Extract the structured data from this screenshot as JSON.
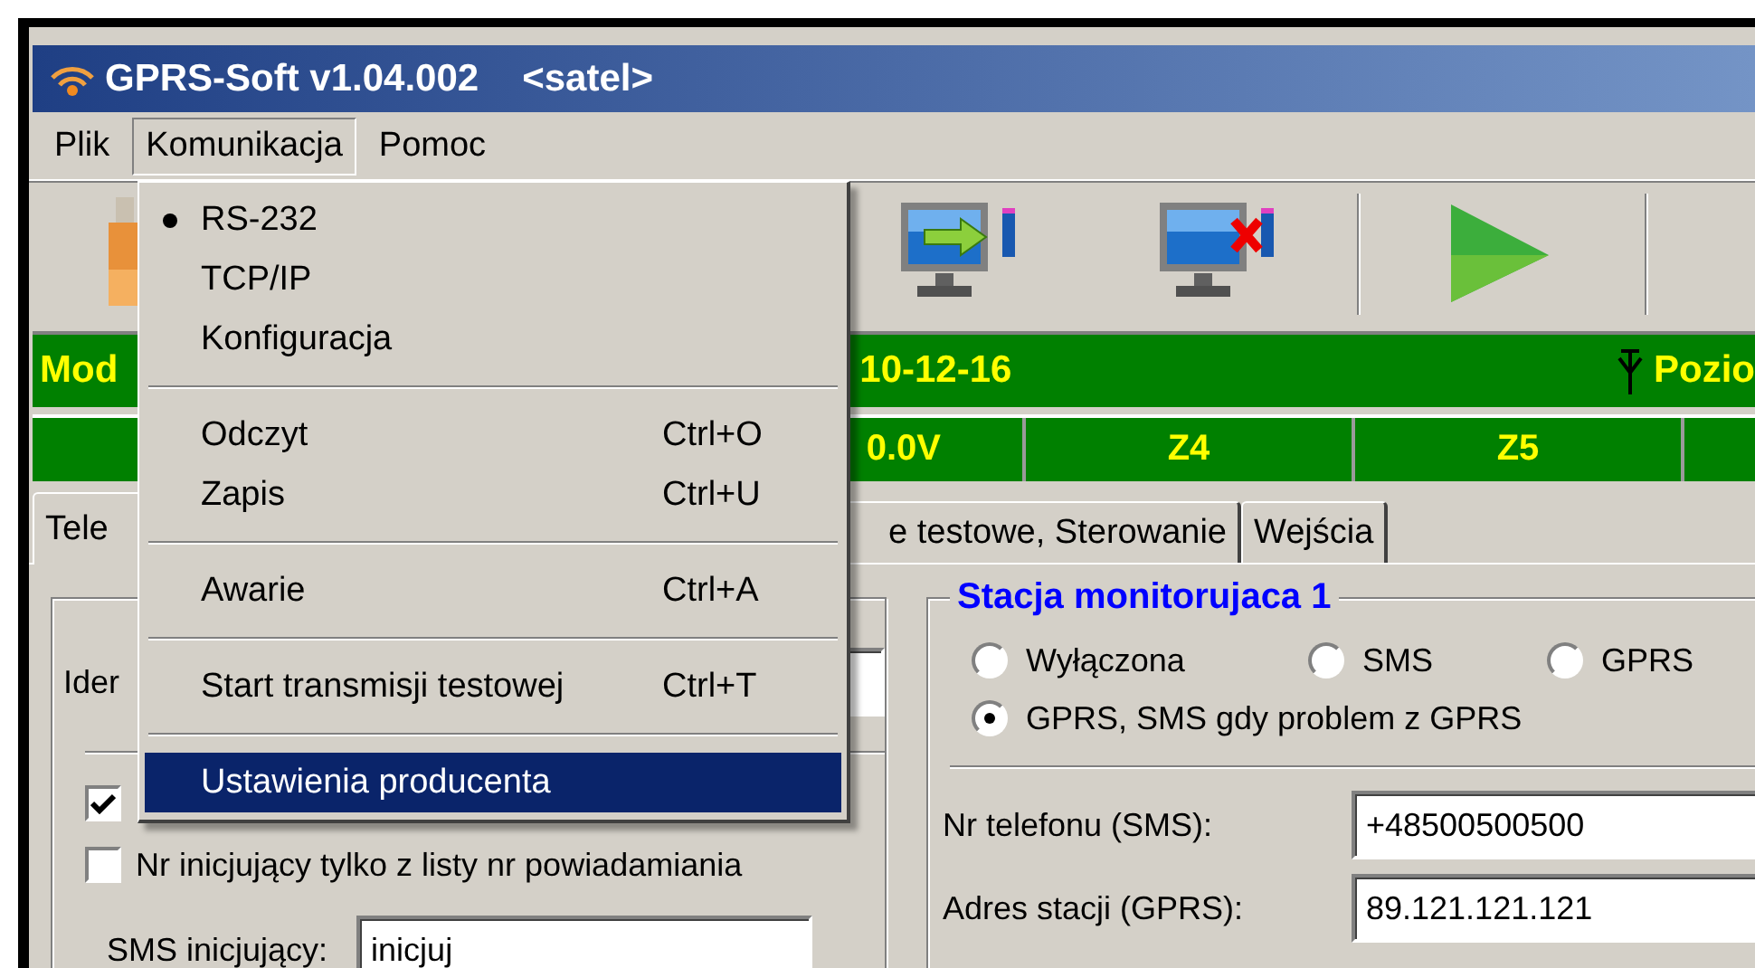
{
  "window": {
    "title": "GPRS-Soft v1.04.002",
    "subtitle": "<satel>"
  },
  "menu_bar": [
    {
      "label": "Plik",
      "selected": false
    },
    {
      "label": "Komunikacja",
      "selected": true
    },
    {
      "label": "Pomoc",
      "selected": false
    }
  ],
  "menu": [
    {
      "kind": "item",
      "label": "RS-232",
      "checked": true,
      "selected": false
    },
    {
      "kind": "item",
      "label": "TCP/IP",
      "checked": false,
      "selected": false
    },
    {
      "kind": "item",
      "label": "Konfiguracja",
      "checked": false,
      "selected": false
    },
    {
      "kind": "separator"
    },
    {
      "kind": "item",
      "label": "Odczyt",
      "shortcut": "Ctrl+O",
      "checked": false,
      "selected": false
    },
    {
      "kind": "item",
      "label": "Zapis",
      "shortcut": "Ctrl+U",
      "checked": false,
      "selected": false
    },
    {
      "kind": "separator"
    },
    {
      "kind": "item",
      "label": "Awarie",
      "shortcut": "Ctrl+A",
      "checked": false,
      "selected": false
    },
    {
      "kind": "separator"
    },
    {
      "kind": "item",
      "label": "Start transmisji testowej",
      "shortcut": "Ctrl+T",
      "checked": false,
      "selected": false
    },
    {
      "kind": "separator"
    },
    {
      "kind": "item",
      "label": "Ustawienia producenta",
      "checked": false,
      "selected": true
    }
  ],
  "status_bar": {
    "left": "Mod",
    "date": "10-12-16",
    "right": "Pozio"
  },
  "zones": [
    "0.0V",
    "Z4",
    "Z5"
  ],
  "tabs": [
    {
      "label": "Tele",
      "selected": true
    },
    {
      "label": "e testowe, Sterowanie",
      "selected": false
    },
    {
      "label": "Wejścia",
      "selected": false
    }
  ],
  "left_group": {
    "id_label": "Ider",
    "checkboxes": [
      {
        "checked": true
      },
      {
        "label": "Nr inicjujący tylko z listy nr powiadamiania",
        "checked": false
      }
    ],
    "sms_label": "SMS inicjujący:",
    "sms_value": "inicjuj"
  },
  "station": {
    "title": "Stacja monitorujaca 1",
    "modes": [
      {
        "label": "Wyłączona",
        "selected": false
      },
      {
        "label": "SMS",
        "selected": false
      },
      {
        "label": "GPRS",
        "selected": false
      },
      {
        "label": "GPRS, SMS gdy problem z GPRS",
        "selected": true
      }
    ],
    "fields": [
      {
        "label": "Nr telefonu (SMS):",
        "value": "+48500500500"
      },
      {
        "label": "Adres stacji (GPRS):",
        "value": "89.121.121.121"
      }
    ]
  }
}
